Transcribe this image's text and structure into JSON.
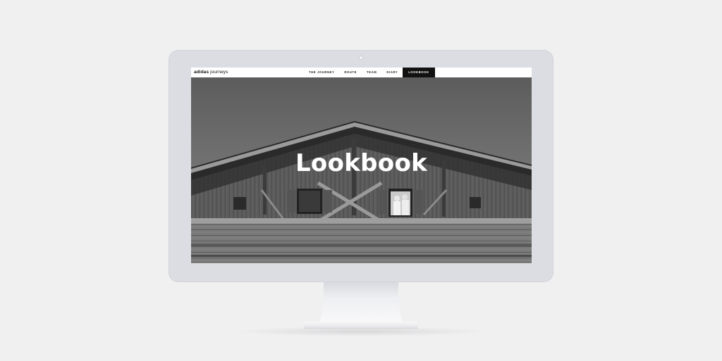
{
  "brand": {
    "bold": "adidas",
    "light": "journeys"
  },
  "nav": {
    "items": [
      {
        "label": "THE JOURNEY"
      },
      {
        "label": "ROUTE"
      },
      {
        "label": "TEAM"
      },
      {
        "label": "DIARY"
      },
      {
        "label": "LOOKBOOK",
        "active": true
      }
    ]
  },
  "hero": {
    "title": "Lookbook"
  },
  "colors": {
    "background": "#f0f0f1",
    "monitor_bezel": "#dcdde3",
    "nav_active_bg": "#111111",
    "hero_title": "#ffffff"
  }
}
